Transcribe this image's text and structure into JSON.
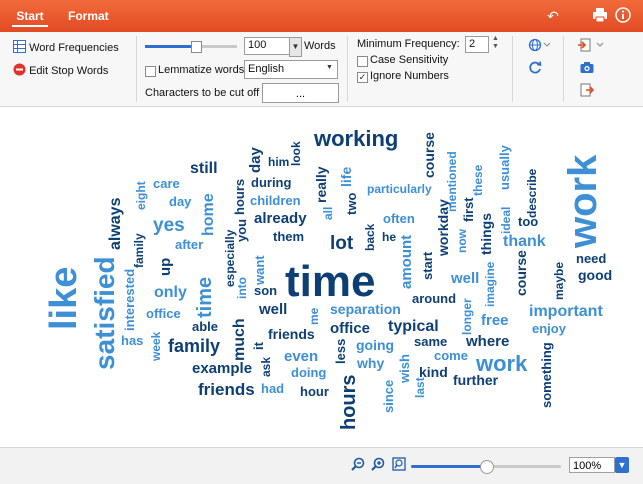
{
  "tabs": [
    {
      "label": "Start"
    },
    {
      "label": "Format"
    }
  ],
  "titlebar": {
    "undo_icon": "undo-icon",
    "print_icon": "print-icon",
    "info_icon": "info-icon"
  },
  "ribbon": {
    "word_frequencies_label": "Word Frequencies",
    "edit_stop_words_label": "Edit Stop Words",
    "max_words_value": "100",
    "words_label": "Words",
    "lemmatize_label": "Lemmatize words",
    "lemmatize_checked": false,
    "language_value": "English",
    "chars_cut_label": "Characters to be cut off",
    "chars_cut_value": "...",
    "min_frequency_label": "Minimum Frequency:",
    "min_frequency_value": "2",
    "case_sensitivity_label": "Case Sensitivity",
    "case_sensitivity_checked": false,
    "ignore_numbers_label": "Ignore Numbers",
    "ignore_numbers_checked": true,
    "check_mark": "✓",
    "max_words_fraction": 0.55
  },
  "statusbar": {
    "zoom_value": "100%",
    "zoom_fraction": 0.5
  },
  "colors": {
    "dark": "#0d3f75",
    "light": "#3d8fd6",
    "accent": "#e24b24"
  },
  "cloud": [
    {
      "t": "time",
      "c": "dark"
    },
    {
      "t": "like",
      "c": "light"
    },
    {
      "t": "work",
      "c": "light"
    },
    {
      "t": "satisfied",
      "c": "light"
    },
    {
      "t": "working",
      "c": "dark"
    },
    {
      "t": "hours",
      "c": "dark"
    },
    {
      "t": "work",
      "c": "light"
    },
    {
      "t": "family",
      "c": "dark"
    },
    {
      "t": "friends",
      "c": "dark"
    },
    {
      "t": "much",
      "c": "dark"
    },
    {
      "t": "lot",
      "c": "dark"
    },
    {
      "t": "yes",
      "c": "light"
    },
    {
      "t": "time",
      "c": "light"
    },
    {
      "t": "home",
      "c": "light"
    },
    {
      "t": "important",
      "c": "light"
    },
    {
      "t": "separation",
      "c": "light"
    },
    {
      "t": "typical",
      "c": "dark"
    },
    {
      "t": "office",
      "c": "dark"
    },
    {
      "t": "where",
      "c": "dark"
    },
    {
      "t": "amount",
      "c": "light"
    },
    {
      "t": "thank",
      "c": "light"
    },
    {
      "t": "course",
      "c": "dark"
    },
    {
      "t": "always",
      "c": "dark"
    },
    {
      "t": "still",
      "c": "dark"
    },
    {
      "t": "only",
      "c": "light"
    },
    {
      "t": "office",
      "c": "light"
    },
    {
      "t": "up",
      "c": "dark"
    },
    {
      "t": "example",
      "c": "dark"
    },
    {
      "t": "even",
      "c": "light"
    },
    {
      "t": "well",
      "c": "dark"
    },
    {
      "t": "well",
      "c": "light"
    },
    {
      "t": "free",
      "c": "light"
    },
    {
      "t": "already",
      "c": "dark"
    },
    {
      "t": "good",
      "c": "dark"
    },
    {
      "t": "need",
      "c": "dark"
    },
    {
      "t": "day",
      "c": "dark"
    },
    {
      "t": "day",
      "c": "light"
    },
    {
      "t": "care",
      "c": "light"
    },
    {
      "t": "after",
      "c": "light"
    },
    {
      "t": "eight",
      "c": "light"
    },
    {
      "t": "family",
      "c": "dark"
    },
    {
      "t": "interested",
      "c": "light"
    },
    {
      "t": "has",
      "c": "light"
    },
    {
      "t": "week",
      "c": "light"
    },
    {
      "t": "able",
      "c": "dark"
    },
    {
      "t": "especially",
      "c": "dark"
    },
    {
      "t": "into",
      "c": "light"
    },
    {
      "t": "want",
      "c": "light"
    },
    {
      "t": "son",
      "c": "dark"
    },
    {
      "t": "it",
      "c": "dark"
    },
    {
      "t": "ask",
      "c": "dark"
    },
    {
      "t": "had",
      "c": "light"
    },
    {
      "t": "doing",
      "c": "light"
    },
    {
      "t": "hour",
      "c": "dark"
    },
    {
      "t": "friends",
      "c": "dark"
    },
    {
      "t": "me",
      "c": "light"
    },
    {
      "t": "less",
      "c": "dark"
    },
    {
      "t": "going",
      "c": "light"
    },
    {
      "t": "why",
      "c": "light"
    },
    {
      "t": "since",
      "c": "light"
    },
    {
      "t": "wish",
      "c": "light"
    },
    {
      "t": "last",
      "c": "light"
    },
    {
      "t": "kind",
      "c": "dark"
    },
    {
      "t": "same",
      "c": "dark"
    },
    {
      "t": "come",
      "c": "light"
    },
    {
      "t": "further",
      "c": "dark"
    },
    {
      "t": "around",
      "c": "dark"
    },
    {
      "t": "longer",
      "c": "light"
    },
    {
      "t": "imagine",
      "c": "light"
    },
    {
      "t": "course",
      "c": "dark"
    },
    {
      "t": "enjoy",
      "c": "light"
    },
    {
      "t": "something",
      "c": "dark"
    },
    {
      "t": "maybe",
      "c": "dark"
    },
    {
      "t": "too",
      "c": "dark"
    },
    {
      "t": "describe",
      "c": "dark"
    },
    {
      "t": "usually",
      "c": "light"
    },
    {
      "t": "these",
      "c": "light"
    },
    {
      "t": "ideal",
      "c": "light"
    },
    {
      "t": "things",
      "c": "dark"
    },
    {
      "t": "first",
      "c": "dark"
    },
    {
      "t": "now",
      "c": "light"
    },
    {
      "t": "workday",
      "c": "dark"
    },
    {
      "t": "start",
      "c": "dark"
    },
    {
      "t": "mentioned",
      "c": "light"
    },
    {
      "t": "particularly",
      "c": "light"
    },
    {
      "t": "often",
      "c": "light"
    },
    {
      "t": "he",
      "c": "dark"
    },
    {
      "t": "back",
      "c": "dark"
    },
    {
      "t": "two",
      "c": "dark"
    },
    {
      "t": "all",
      "c": "light"
    },
    {
      "t": "really",
      "c": "dark"
    },
    {
      "t": "life",
      "c": "light"
    },
    {
      "t": "during",
      "c": "dark"
    },
    {
      "t": "him",
      "c": "dark"
    },
    {
      "t": "look",
      "c": "dark"
    },
    {
      "t": "children",
      "c": "light"
    },
    {
      "t": "them",
      "c": "dark"
    },
    {
      "t": "you",
      "c": "dark"
    },
    {
      "t": "hours",
      "c": "dark"
    }
  ]
}
